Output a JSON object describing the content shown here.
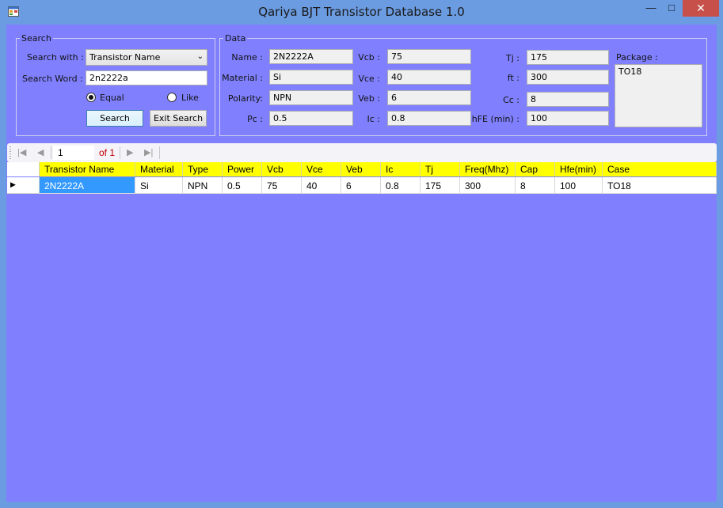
{
  "window": {
    "title": "Qariya BJT Transistor Database 1.0",
    "minimize_glyph": "—",
    "maximize_glyph": "□",
    "close_glyph": "✕",
    "client_color": "#8080ff",
    "header_color": "#ffff00",
    "selection_color": "#3399ff"
  },
  "search": {
    "legend": "Search",
    "search_with_label": "Search with :",
    "search_with_value": "Transistor Name",
    "search_word_label": "Search Word :",
    "search_word_value": "2n2222a",
    "radio_equal_label": "Equal",
    "radio_like_label": "Like",
    "selected_mode": "Equal",
    "search_button": "Search",
    "exit_button": "Exit Search"
  },
  "data": {
    "legend": "Data",
    "name_label": "Name :",
    "name_value": "2N2222A",
    "material_label": "Material :",
    "material_value": "Si",
    "polarity_label": "Polarity:",
    "polarity_value": "NPN",
    "pc_label": "Pc :",
    "pc_value": "0.5",
    "vcb_label": "Vcb :",
    "vcb_value": "75",
    "vce_label": "Vce :",
    "vce_value": "40",
    "veb_label": "Veb :",
    "veb_value": "6",
    "ic_label": "Ic :",
    "ic_value": "0.8",
    "tj_label": "Tj :",
    "tj_value": "175",
    "ft_label": "ft :",
    "ft_value": "300",
    "cc_label": "Cc :",
    "cc_value": "8",
    "hfe_label": "hFE (min) :",
    "hfe_value": "100",
    "package_label": "Package :",
    "package_value": "TO18"
  },
  "navigator": {
    "position": "1",
    "of_text": "of 1"
  },
  "grid": {
    "columns": [
      "Transistor Name",
      "Material",
      "Type",
      "Power",
      "Vcb",
      "Vce",
      "Veb",
      "Ic",
      "Tj",
      "Freq(Mhz)",
      "Cap",
      "Hfe(min)",
      "Case"
    ],
    "rows": [
      [
        "2N2222A",
        "Si",
        "NPN",
        "0.5",
        "75",
        "40",
        "6",
        "0.8",
        "175",
        "300",
        "8",
        "100",
        "TO18"
      ]
    ]
  }
}
